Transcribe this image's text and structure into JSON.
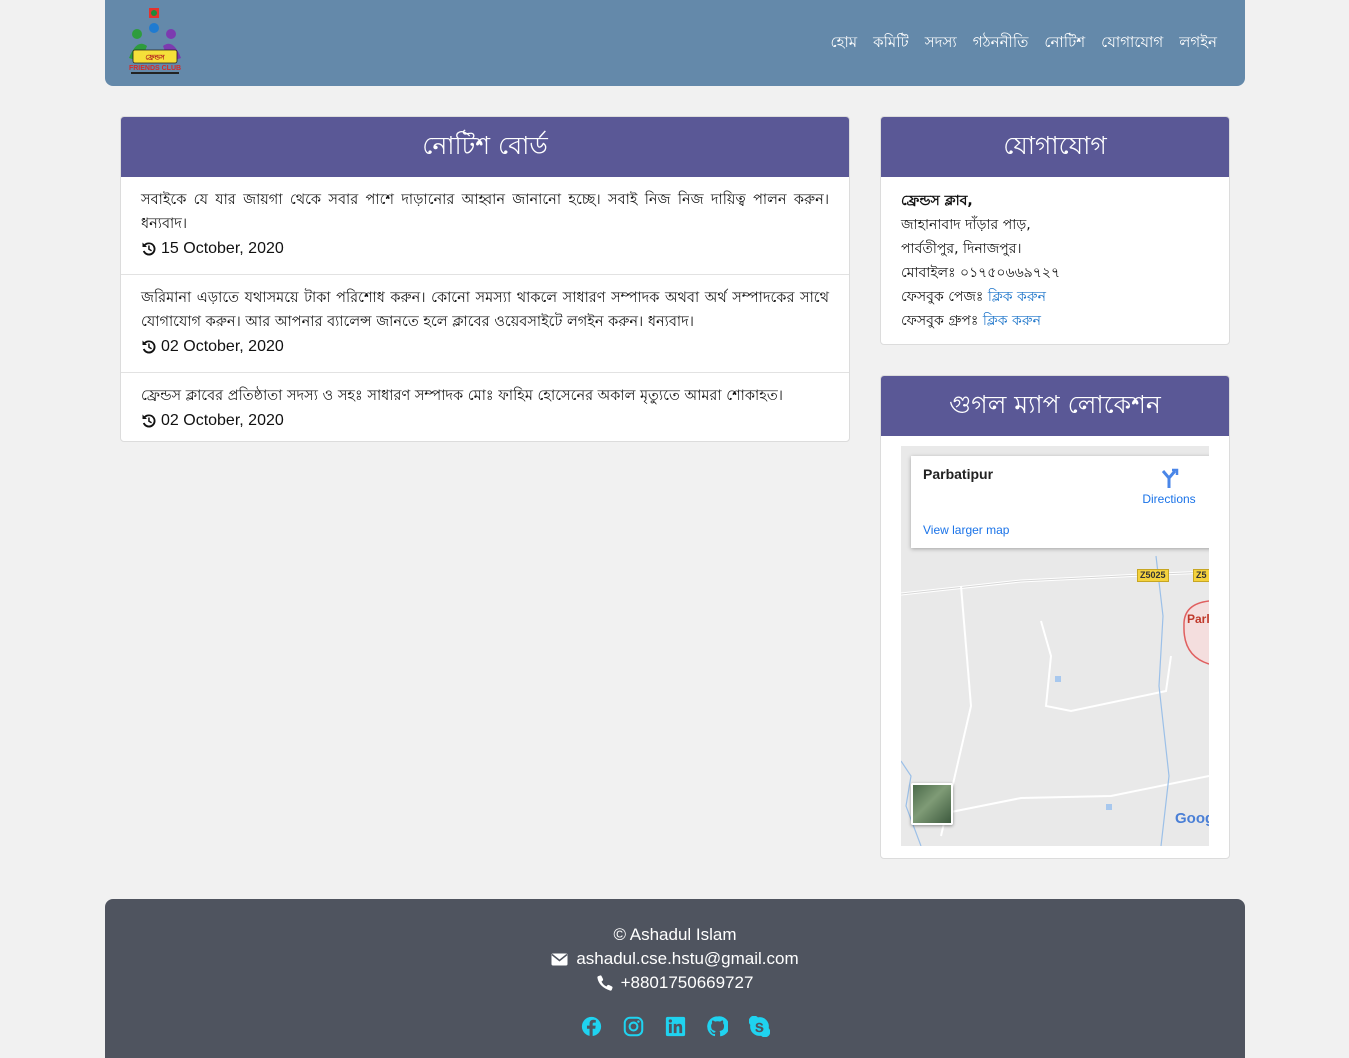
{
  "brand": {
    "logo_text": "FRIENDS CLUB"
  },
  "nav": {
    "items": [
      "হোম",
      "কমিটি",
      "সদস্য",
      "গঠননীতি",
      "নোটিশ",
      "যোগাযোগ",
      "লগইন"
    ]
  },
  "notice_board": {
    "title": "নোটিশ বোর্ড",
    "items": [
      {
        "text": "সবাইকে যে যার জায়গা থেকে সবার পাশে দাড়ানোর আহ্বান জানানো হচ্ছে। সবাই নিজ নিজ দায়িত্ব পালন করুন। ধন্যবাদ।",
        "date": "15 October, 2020"
      },
      {
        "text": "জরিমানা এড়াতে যথাসময়ে টাকা পরিশোধ করুন। কোনো সমস্যা থাকলে সাধারণ সম্পাদক অথবা অর্থ সম্পাদকের সাথে যোগাযোগ করুন। আর আপনার ব্যালেন্স জানতে হলে ক্লাবের ওয়েবসাইটে লগইন করুন। ধন্যবাদ।",
        "date": "02 October, 2020"
      },
      {
        "text": "ফ্রেন্ডস ক্লাবের প্রতিষ্ঠাতা সদস্য ও সহঃ সাধারণ সম্পাদক মোঃ ফাহিম হোসেনের অকাল মৃত্যুতে আমরা শোকাহত।",
        "date": "02 October, 2020"
      }
    ]
  },
  "contact": {
    "title": "যোগাযোগ",
    "name": "ফ্রেন্ডস ক্লাব,",
    "address1": "জাহানাবাদ দাঁড়ার পাড়,",
    "address2": "পার্বতীপুর, দিনাজপুর।",
    "mobile": "মোবাইলঃ ০১৭৫০৬৬৯৭২৭",
    "fb_page_label": "ফেসবুক পেজঃ",
    "fb_page_link": "ক্লিক করুন",
    "fb_group_label": "ফেসবুক গ্রুপঃ",
    "fb_group_link": "ক্লিক করুন"
  },
  "map": {
    "title": "গুগল ম্যাপ লোকেশন",
    "place": "Parbatipur",
    "directions": "Directions",
    "larger": "View larger map",
    "road1": "Z5025",
    "road2": "Z5",
    "town_label": "Parl",
    "google": "Goog"
  },
  "footer": {
    "copyright": "© Ashadul Islam",
    "email": "ashadul.cse.hstu@gmail.com",
    "phone": "+8801750669727",
    "social_icons": [
      "facebook-icon",
      "instagram-icon",
      "linkedin-icon",
      "github-icon",
      "skype-icon"
    ],
    "icon_color": "#1fd3f0"
  },
  "colors": {
    "navbar": "#6489aa",
    "card_header": "#5a5896",
    "footer": "#4f545f",
    "link": "#1a73c9"
  }
}
